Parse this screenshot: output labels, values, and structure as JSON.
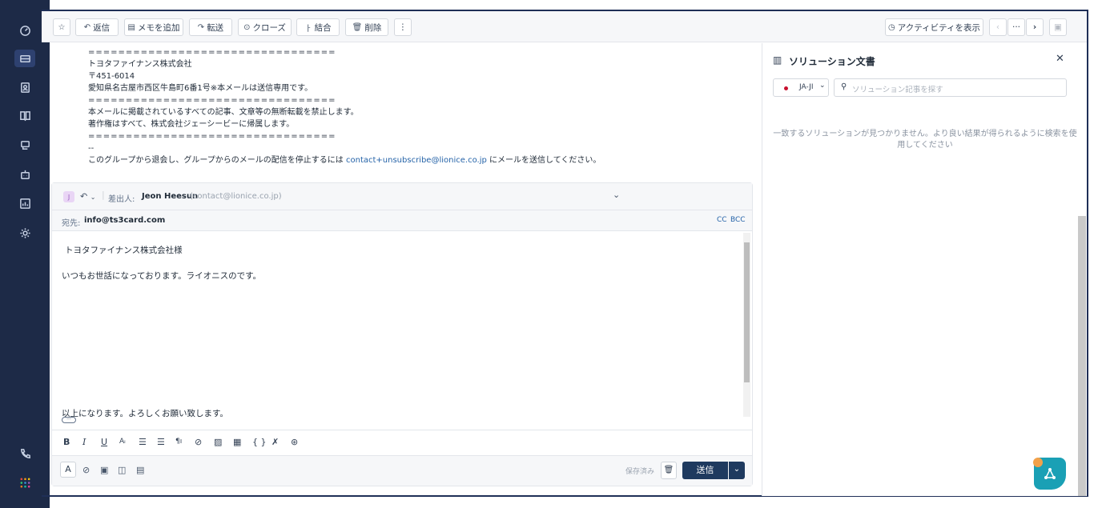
{
  "toolbar": {
    "reply": "返信",
    "add_memo": "メモを追加",
    "forward": "転送",
    "close": "クローズ",
    "merge": "結合",
    "delete": "削除",
    "more": "⋮",
    "show_activity": "アクティビティを表示",
    "nav_more": "···"
  },
  "message": {
    "lines": [
      "=================================",
      "トヨタファイナンス株式会社",
      "〒451-6014",
      "愛知県名古屋市西区牛島町6番1号※本メールは送信専用です。",
      "=================================",
      "本メールに掲載されているすべての記事、文章等の無断転載を禁止します。",
      "著作権はすべて、株式会社ジェーシービーに帰属します。",
      "=================================",
      "--"
    ],
    "unsubscribe_prefix": "このグループから退会し、グループからのメールの配信を停止するには ",
    "unsubscribe_email": "contact+unsubscribe@lionice.co.jp",
    "unsubscribe_suffix": " にメールを送信してください。"
  },
  "composer": {
    "avatar_letter": "J",
    "from_label": "差出人:",
    "from_name": "Jeon Heesun",
    "from_email": "(contact@lionice.co.jp)",
    "to_label": "宛先:",
    "to_value": "info@ts3card.com",
    "cc": "CC",
    "bcc": "BCC",
    "body": [
      "トヨタファイナンス株式会社様",
      "いつもお世話になっております。ライオニスのです。",
      "以上になります。よろしくお願い致します。"
    ],
    "saved": "保存済み",
    "send": "送信"
  },
  "panel": {
    "title": "ソリューション文書",
    "language": "JA-JI",
    "search_placeholder": "ソリューション記事を探す",
    "empty_message": "一致するソリューションが見つかりません。より良い結果が得られるように検索を使用してください"
  },
  "colors": {
    "rail": "#1d2a47",
    "accent": "#1f3a5f",
    "link": "#2563a8",
    "fab": "#1aa0b5",
    "lang_dot": "#c8102e"
  }
}
